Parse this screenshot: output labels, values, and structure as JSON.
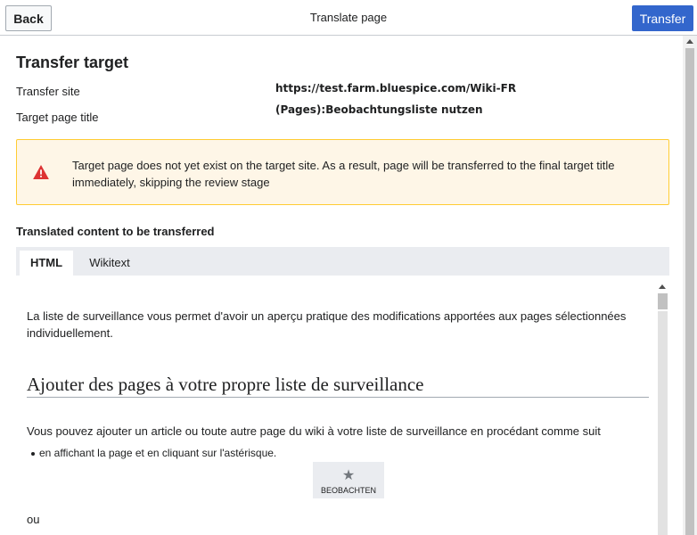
{
  "header": {
    "back_label": "Back",
    "title": "Translate page",
    "transfer_label": "Transfer"
  },
  "transfer": {
    "section_title": "Transfer target",
    "site_label": "Transfer site",
    "site_value": "https://test.farm.bluespice.com/Wiki-FR",
    "title_label": "Target page title",
    "title_value": "(Pages):Beobachtungsliste nutzen"
  },
  "warning": {
    "icon": "warning-triangle-icon",
    "color": "#dd3333",
    "text": "Target page does not yet exist on the target site. As a result, page will be transferred to the final target title immediately, skipping the review stage"
  },
  "content": {
    "label": "Translated content to be transferred",
    "tabs": [
      {
        "label": "HTML",
        "active": true
      },
      {
        "label": "Wikitext",
        "active": false
      }
    ],
    "paragraph1": "La liste de surveillance vous permet d'avoir un aperçu pratique des modifications apportées aux pages sélectionnées individuellement.",
    "heading": "Ajouter des pages à votre propre liste de surveillance",
    "paragraph2": "Vous pouvez ajouter un article ou toute autre page du wiki à votre liste de surveillance en procédant comme suit",
    "bullet1": "en affichant la page et en cliquant sur l'astérisque.",
    "watch_button": {
      "icon": "star-icon",
      "label": "BEOBACHTEN"
    },
    "trailing": "ou"
  },
  "colors": {
    "accent": "#3366cc",
    "warning_bg": "#fef6e7",
    "warning_border": "#ffcc33"
  }
}
